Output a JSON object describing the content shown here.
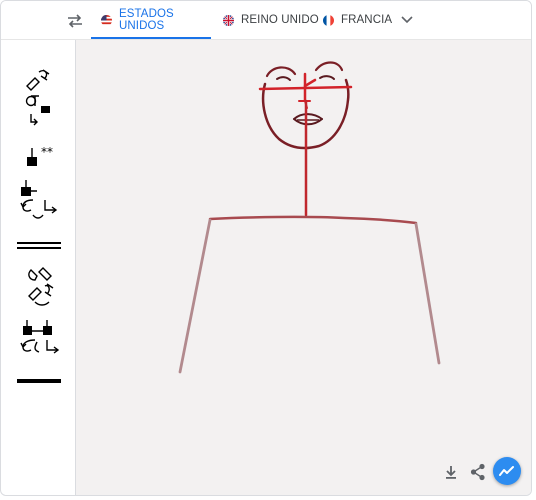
{
  "tabs": [
    {
      "label": "ESTADOS UNIDOS",
      "flag": "us-flag-icon",
      "active": true
    },
    {
      "label": "REINO UNIDO",
      "flag": "uk-flag-icon",
      "active": false
    },
    {
      "label": "FRANCIA",
      "flag": "fr-flag-icon",
      "active": false
    }
  ],
  "toolbar": {
    "swap_icon": "swap-arrows-icon",
    "more_icon": "chevron-down-icon"
  },
  "sidebar": {
    "tools": [
      "signwriting-hand-rotation-icon",
      "signwriting-contact-star-icon",
      "signwriting-hand-movement-icon",
      "double-line-icon",
      "signwriting-face-hands-icon",
      "signwriting-two-hands-movement-icon",
      "thick-line-icon"
    ]
  },
  "canvas": {
    "drawing": "stick-figure-sketch"
  },
  "actions": {
    "download_icon": "download-icon",
    "share_icon": "share-icon",
    "fab_icon": "trend-chart-icon"
  },
  "colors": {
    "accent": "#1a73e8",
    "fab": "#2d8cf0",
    "face_stroke": "#7a1f26",
    "red_stroke": "#d2232a",
    "body_stroke": "#b28a8e",
    "canvas_bg": "#f3f1f1"
  }
}
